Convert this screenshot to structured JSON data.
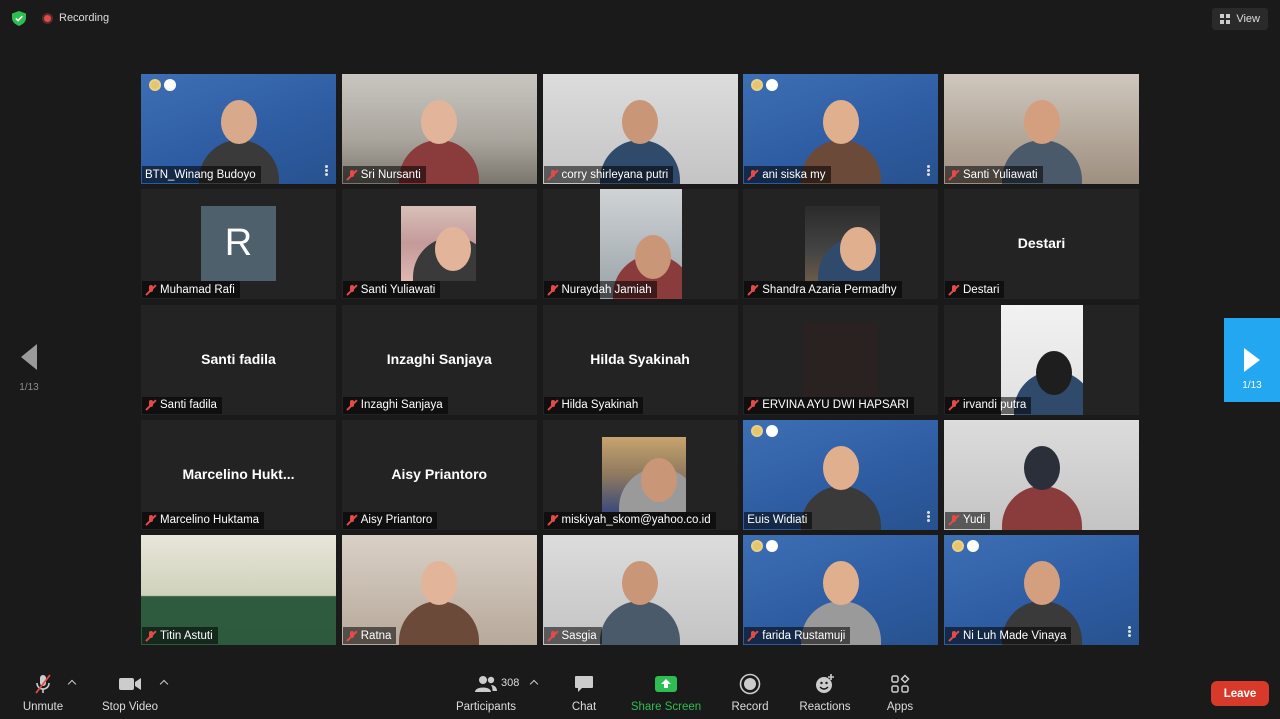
{
  "top": {
    "recording_label": "Recording",
    "view_label": "View"
  },
  "nav": {
    "left_page": "1/13",
    "right_page": "1/13"
  },
  "participants": [
    {
      "name": "BTN_Winang Budoyo",
      "muted": false,
      "video": "webinar"
    },
    {
      "name": "Sri Nursanti",
      "muted": true,
      "video": "room"
    },
    {
      "name": "corry shirleyana putri",
      "muted": true,
      "video": "light"
    },
    {
      "name": "ani siska my",
      "muted": true,
      "video": "webinar"
    },
    {
      "name": "Santi Yuliawati",
      "muted": true,
      "video": "home"
    },
    {
      "name": "Muhamad Rafi",
      "muted": true,
      "video": "avatar",
      "initial": "R"
    },
    {
      "name": "Santi Yuliawati",
      "muted": true,
      "video": "pic"
    },
    {
      "name": "Nuraydah Jamiah",
      "muted": true,
      "video": "pic-tall"
    },
    {
      "name": "Shandra Azaria Permadhy",
      "muted": true,
      "video": "pic"
    },
    {
      "name": "Destari",
      "muted": true,
      "video": "none",
      "center": "Destari"
    },
    {
      "name": "Santi fadila",
      "muted": true,
      "video": "none",
      "center": "Santi fadila"
    },
    {
      "name": "Inzaghi Sanjaya",
      "muted": true,
      "video": "none",
      "center": "Inzaghi Sanjaya"
    },
    {
      "name": "Hilda Syakinah",
      "muted": true,
      "video": "none",
      "center": "Hilda Syakinah"
    },
    {
      "name": "ERVINA AYU DWI HAPSARI",
      "muted": true,
      "video": "dark"
    },
    {
      "name": "irvandi putra",
      "muted": true,
      "video": "pic-tall"
    },
    {
      "name": "Marcelino Huktama",
      "muted": true,
      "video": "none",
      "center": "Marcelino  Hukt..."
    },
    {
      "name": "Aisy Priantoro",
      "muted": true,
      "video": "none",
      "center": "Aisy Priantoro"
    },
    {
      "name": "miskiyah_skom@yahoo.co.id",
      "muted": true,
      "video": "pic"
    },
    {
      "name": "Euis Widiati",
      "muted": false,
      "video": "webinar",
      "active": true
    },
    {
      "name": "Yudi",
      "muted": true,
      "video": "light"
    },
    {
      "name": "Titin Astuti",
      "muted": true,
      "video": "green"
    },
    {
      "name": "Ratna",
      "muted": true,
      "video": "warm"
    },
    {
      "name": "Sasgia",
      "muted": true,
      "video": "light"
    },
    {
      "name": "farida Rustamuji",
      "muted": true,
      "video": "webinar"
    },
    {
      "name": "Ni Luh Made Vinaya",
      "muted": true,
      "video": "webinar"
    }
  ],
  "toolbar": {
    "unmute": "Unmute",
    "stop_video": "Stop Video",
    "participants": "Participants",
    "participants_count": "308",
    "chat": "Chat",
    "share_screen": "Share Screen",
    "record": "Record",
    "reactions": "Reactions",
    "apps": "Apps",
    "leave": "Leave"
  },
  "colors": {
    "share_green": "#2dbd52",
    "leave_red": "#d73a2b",
    "nav_blue": "#22a7f0",
    "active_border": "#b4e04a"
  }
}
